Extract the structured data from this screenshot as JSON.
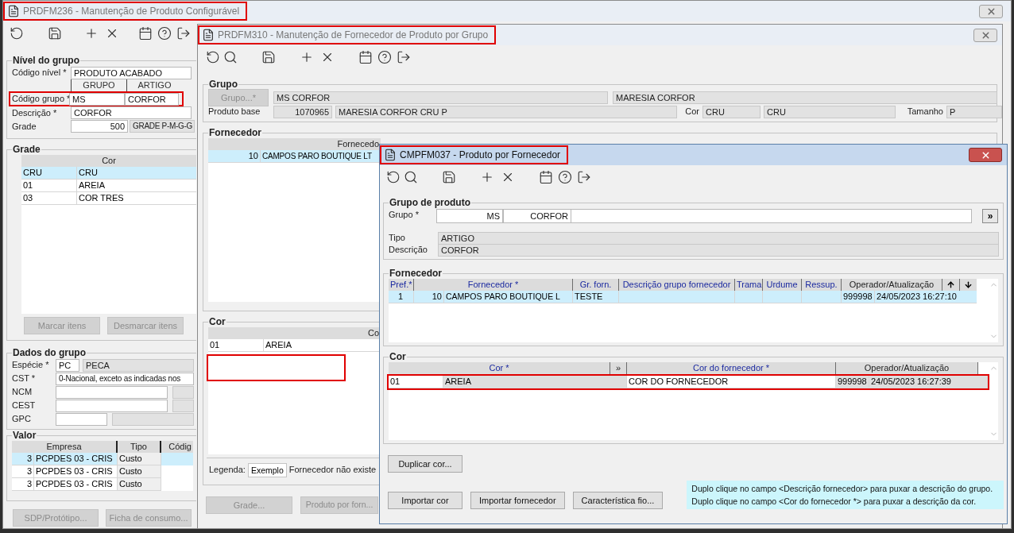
{
  "back_window": {
    "title": "PRDFM236 - Manutenção de Produto Configurável",
    "active": false,
    "highlighted": true,
    "nivel_do_grupo": {
      "title": "Nível do grupo",
      "codigo_nivel": {
        "label": "Código nível *",
        "value": "PRODUTO ACABADO"
      },
      "column_headers": [
        "GRUPO",
        "ARTIGO"
      ],
      "codigo_grupo": {
        "label": "Código grupo *",
        "grupo": "MS",
        "artigo": "CORFOR",
        "highlighted": true
      },
      "descricao": {
        "label": "Descrição *",
        "value": "CORFOR"
      },
      "grade": {
        "label": "Grade",
        "code": "500",
        "description": "GRADE P-M-G-G"
      }
    },
    "grade": {
      "title": "Grade",
      "column": "Cor",
      "rows": [
        {
          "code": "CRU",
          "name": "CRU",
          "selected": true
        },
        {
          "code": "01",
          "name": "AREIA",
          "selected": false
        },
        {
          "code": "03",
          "name": "COR TRES",
          "selected": false
        }
      ],
      "buttons": [
        {
          "label": "Marcar itens",
          "disabled": true
        },
        {
          "label": "Desmarcar itens",
          "disabled": true
        }
      ]
    },
    "dados_do_grupo": {
      "title": "Dados do grupo",
      "especie": {
        "label": "Espécie *",
        "code": "PC",
        "name": "PECA"
      },
      "cst": {
        "label": "CST *",
        "value": "0-Nacional, exceto as indicadas nos"
      },
      "ncm": {
        "label": "NCM"
      },
      "cest": {
        "label": "CEST"
      },
      "gpc": {
        "label": "GPC"
      }
    },
    "valor": {
      "title": "Valor",
      "columns": [
        "Empresa",
        "Tipo",
        "Códig"
      ],
      "rows": [
        {
          "code": "3",
          "empresa": "PCPDES 03 - CRIS",
          "tipo": "Custo",
          "selected": true
        },
        {
          "code": "3",
          "empresa": "PCPDES 03 - CRIS",
          "tipo": "Custo",
          "selected": false
        },
        {
          "code": "3",
          "empresa": "PCPDES 03 - CRIS",
          "tipo": "Custo",
          "selected": false
        }
      ]
    },
    "buttons": [
      {
        "label": "SDP/Protótipo...",
        "disabled": true
      },
      {
        "label": "Ficha de consumo...",
        "disabled": true
      }
    ]
  },
  "middle_window": {
    "title": "PRDFM310 - Manutenção de Fornecedor de Produto por Grupo",
    "active": false,
    "highlighted": true,
    "grupo": {
      "title": "Grupo",
      "grupo_button": {
        "label": "Grupo...*",
        "disabled": true
      },
      "grupo_value": "MS CORFOR",
      "grupo_description": "MARESIA CORFOR",
      "produto_base": {
        "label": "Produto base",
        "code": "1070965",
        "description": "MARESIA CORFOR CRU P"
      },
      "cor": {
        "label": "Cor",
        "code": "CRU",
        "description": "CRU"
      },
      "tamanho": {
        "label": "Tamanho",
        "value": "P"
      }
    },
    "fornecedor": {
      "title": "Fornecedor",
      "column": "Fornecedo",
      "rows": [
        {
          "code": "10",
          "name": "CAMPOS PARO BOUTIQUE LT",
          "selected": true
        }
      ]
    },
    "cor": {
      "title": "Cor",
      "column": "Co",
      "rows": [
        {
          "code": "01",
          "name": "AREIA",
          "selected": false
        }
      ],
      "legend": {
        "label": "Legenda:",
        "sample": "Exemplo",
        "text": "Fornecedor não existe"
      }
    },
    "buttons": [
      {
        "label": "Grade...",
        "disabled": true
      },
      {
        "label": "Produto por forn...",
        "disabled": true
      }
    ]
  },
  "front_window": {
    "title": "CMPFM037 - Produto por Fornecedor",
    "active": true,
    "highlighted": true,
    "grupo_de_produto": {
      "title": "Grupo de produto",
      "grupo": {
        "label": "Grupo *",
        "code": "MS",
        "name": "CORFOR"
      },
      "expand_button": "»",
      "tipo": {
        "label": "Tipo",
        "value": "ARTIGO"
      },
      "descricao": {
        "label": "Descrição",
        "value": "CORFOR"
      }
    },
    "fornecedor": {
      "title": "Fornecedor",
      "columns": [
        {
          "label": "Pref.*",
          "editable": true
        },
        {
          "label": "Fornecedor *",
          "editable": true
        },
        {
          "label": "Gr. forn.",
          "editable": true
        },
        {
          "label": "Descrição grupo fornecedor",
          "editable": true
        },
        {
          "label": "Trama",
          "editable": true
        },
        {
          "label": "Urdume",
          "editable": true
        },
        {
          "label": "Ressup.",
          "editable": true
        },
        {
          "label": "Operador/Atualização",
          "editable": false
        }
      ],
      "rows": [
        {
          "pref": "1",
          "codigo": "10",
          "nome": "CAMPOS PARO BOUTIQUE L",
          "gr_forn": "TESTE",
          "operador": "999998",
          "atualizacao": "24/05/2023 16:27:10",
          "selected": true
        }
      ]
    },
    "cor": {
      "title": "Cor",
      "columns": [
        {
          "label": "Cor *",
          "editable": true
        },
        {
          "label": "»",
          "editable": false
        },
        {
          "label": "Cor do fornecedor *",
          "editable": true
        },
        {
          "label": "Operador/Atualização",
          "editable": false
        }
      ],
      "rows": [
        {
          "cor": "01",
          "nome": "AREIA",
          "cor_fornecedor": "COR DO FORNECEDOR",
          "operador": "999998",
          "atualizacao": "24/05/2023 16:27:39",
          "highlighted": true
        }
      ]
    },
    "button_rows": [
      [
        {
          "label": "Duplicar cor...",
          "disabled": false
        }
      ],
      [
        {
          "label": "Importar cor",
          "disabled": false
        },
        {
          "label": "Importar fornecedor",
          "disabled": false
        },
        {
          "label": "Característica fio...",
          "disabled": false
        }
      ]
    ],
    "hints": [
      "Duplo clique no campo <Descrição fornecedor> para puxar a descrição do grupo.",
      "Duplo clique no campo <Cor do fornecedor *> para puxar a descrição da cor."
    ]
  }
}
